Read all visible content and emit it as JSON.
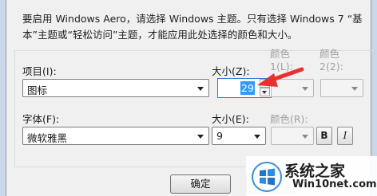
{
  "note": "要启用 Windows Aero，请选择 Windows 主题。只有选择 Windows 7 “基本”主题或“轻松访问”主题，才能应用此处选择的颜色和大小。",
  "item": {
    "label": "项目(I):",
    "value": "图标",
    "size_label": "大小(Z):",
    "size_value": "29",
    "color1_label": "颜色 1(L):",
    "color2_label": "颜色 2(2):"
  },
  "font": {
    "label": "字体(F):",
    "value": "微软雅黑",
    "size_label": "大小(E):",
    "size_value": "9",
    "color_label": "颜色(R):",
    "bold_label": "B",
    "italic_label": "I"
  },
  "buttons": {
    "ok": "确定"
  },
  "watermark": {
    "title": "系统之家",
    "url": "Win10net.com"
  },
  "colors": {
    "annotation_arrow": "#e8312e",
    "selection": "#3399ff",
    "dialog_bg": "#f0f0f0"
  }
}
